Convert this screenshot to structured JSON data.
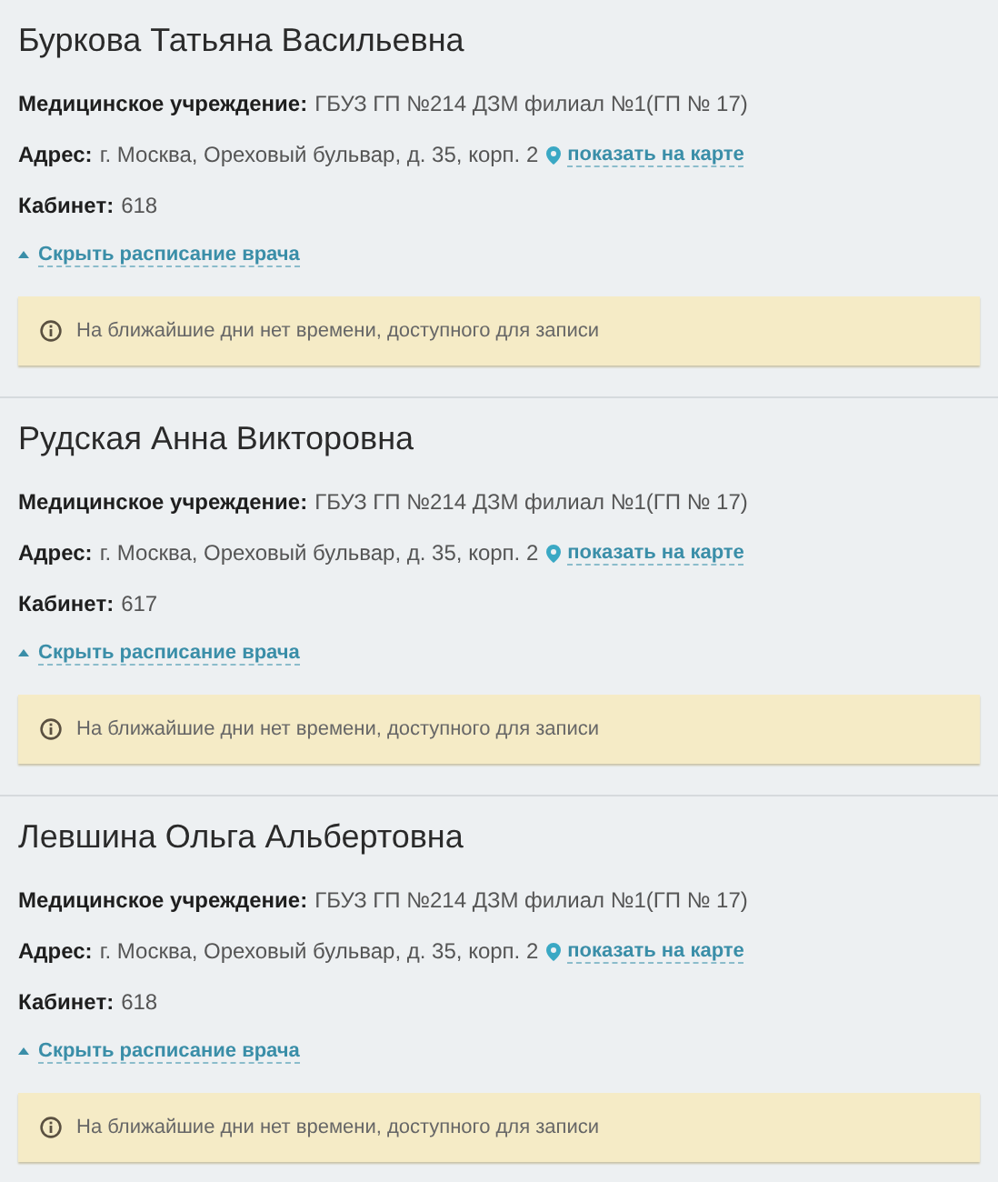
{
  "doctors": [
    {
      "name": "Буркова Татьяна Васильевна",
      "fields": [
        {
          "kind": "text",
          "label": "Медицинское учреждение:",
          "value": "ГБУЗ ГП №214 ДЗМ филиал №1(ГП № 17)"
        },
        {
          "kind": "address",
          "label": "Адрес:",
          "value": "г. Москва, Ореховый бульвар, д. 35, корп. 2",
          "link": "показать на карте"
        },
        {
          "kind": "text",
          "label": "Кабинет:",
          "value": "618"
        }
      ],
      "schedule_toggle": {
        "label": "Скрыть расписание врача",
        "expanded": true
      },
      "notice": "На ближайшие дни нет времени, доступного для записи"
    },
    {
      "name": "Рудская Анна Викторовна",
      "fields": [
        {
          "kind": "text",
          "label": "Медицинское учреждение:",
          "value": "ГБУЗ ГП №214 ДЗМ филиал №1(ГП № 17)"
        },
        {
          "kind": "address",
          "label": "Адрес:",
          "value": "г. Москва, Ореховый бульвар, д. 35, корп. 2",
          "link": "показать на карте"
        },
        {
          "kind": "text",
          "label": "Кабинет:",
          "value": "617"
        }
      ],
      "schedule_toggle": {
        "label": "Скрыть расписание врача",
        "expanded": true
      },
      "notice": "На ближайшие дни нет времени, доступного для записи"
    },
    {
      "name": "Левшина Ольга Альбертовна",
      "fields": [
        {
          "kind": "text",
          "label": "Медицинское учреждение:",
          "value": "ГБУЗ ГП №214 ДЗМ филиал №1(ГП № 17)"
        },
        {
          "kind": "address",
          "label": "Адрес:",
          "value": "г. Москва, Ореховый бульвар, д. 35, корп. 2",
          "link": "показать на карте"
        },
        {
          "kind": "text",
          "label": "Кабинет:",
          "value": "618"
        }
      ],
      "schedule_toggle": {
        "label": "Скрыть расписание врача",
        "expanded": true
      },
      "notice": "На ближайшие дни нет времени, доступного для записи"
    }
  ]
}
